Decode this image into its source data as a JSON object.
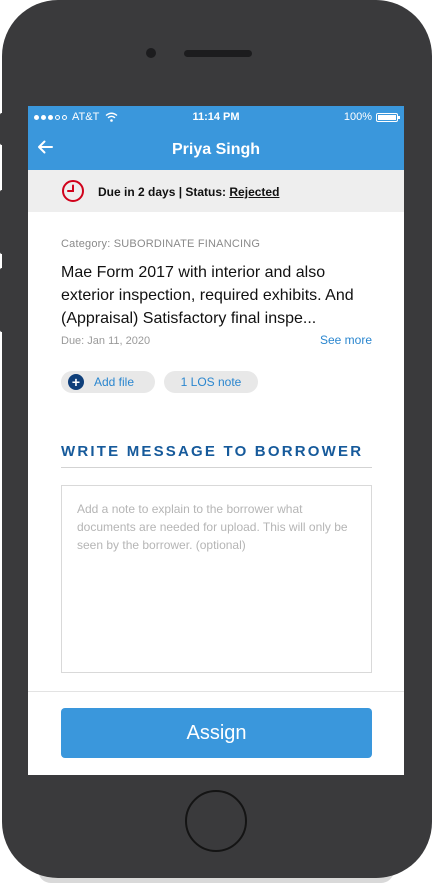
{
  "status_bar": {
    "carrier": "AT&T",
    "time": "11:14 PM",
    "battery": "100%",
    "battery_level": 1.0
  },
  "header": {
    "back_icon": "arrow-left-icon",
    "title": "Priya Singh"
  },
  "due_banner": {
    "icon": "clock-icon",
    "due_text": "Due in 2 days | Status: ",
    "status": "Rejected",
    "accent_color": "#d0021b"
  },
  "item": {
    "category": "Category: SUBORDINATE FINANCING",
    "description": "Mae Form 2017 with interior and also exterior inspection, required exhibits. And (Appraisal) Satisfactory final inspe...",
    "due_date": "Due: Jan 11, 2020",
    "see_more": "See more"
  },
  "chips": {
    "add_file": "Add file",
    "add_file_icon": "plus-circle-icon",
    "los_note": "1 LOS note"
  },
  "message": {
    "section_title": "WRITE MESSAGE TO BORROWER",
    "value": "",
    "placeholder": "Add a note to explain to the borrower what documents are needed for upload. This will only be seen by the borrower. (optional)"
  },
  "actions": {
    "assign_label": "Assign"
  },
  "colors": {
    "primary": "#3a97dc",
    "section_title": "#165a9b",
    "link": "#2a86cf"
  }
}
